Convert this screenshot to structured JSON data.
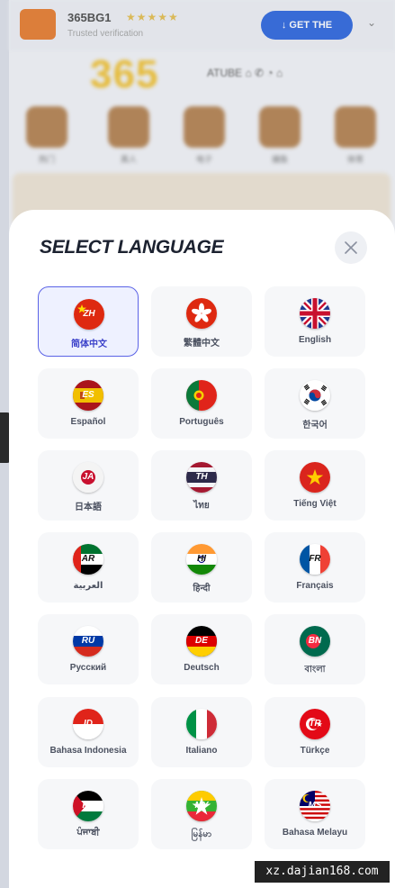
{
  "background": {
    "app_name": "365BG1",
    "stars": "★★★★★",
    "subtitle": "Trusted verification",
    "header_button": "↓ GET THE",
    "brand": "365",
    "top_links": "ATUBE   ⌂   ✆   ◔   ⌂",
    "categories": [
      "热门",
      "真人",
      "电子",
      "捕鱼",
      "体育"
    ]
  },
  "sheet": {
    "title": "SELECT LANGUAGE",
    "close_icon": "close-icon"
  },
  "languages": [
    {
      "code": "ZH",
      "label": "简体中文",
      "selected": true
    },
    {
      "code": "",
      "label": "繁體中文",
      "selected": false
    },
    {
      "code": "",
      "label": "English",
      "selected": false
    },
    {
      "code": "ES",
      "label": "Español",
      "selected": false
    },
    {
      "code": "",
      "label": "Português",
      "selected": false
    },
    {
      "code": "",
      "label": "한국어",
      "selected": false
    },
    {
      "code": "JA",
      "label": "日本語",
      "selected": false
    },
    {
      "code": "TH",
      "label": "ไทย",
      "selected": false
    },
    {
      "code": "",
      "label": "Tiếng Việt",
      "selected": false
    },
    {
      "code": "AR",
      "label": "العربية",
      "selected": false
    },
    {
      "code": "HI",
      "label": "हिन्दी",
      "selected": false
    },
    {
      "code": "FR",
      "label": "Français",
      "selected": false
    },
    {
      "code": "RU",
      "label": "Русский",
      "selected": false
    },
    {
      "code": "DE",
      "label": "Deutsch",
      "selected": false
    },
    {
      "code": "BN",
      "label": "বাংলা",
      "selected": false
    },
    {
      "code": "ID",
      "label": "Bahasa Indonesia",
      "selected": false
    },
    {
      "code": "IT",
      "label": "Italiano",
      "selected": false
    },
    {
      "code": "TR",
      "label": "Türkçe",
      "selected": false
    },
    {
      "code": "PA",
      "label": "ਪੰਜਾਬੀ",
      "selected": false
    },
    {
      "code": "MY",
      "label": "မြန်မာ",
      "selected": false
    },
    {
      "code": "MS",
      "label": "Bahasa Melayu",
      "selected": false
    }
  ],
  "colors": {
    "accent": "#5b63e6",
    "selected_bg": "#eef1ff",
    "card_bg": "#f6f7f9"
  },
  "watermark": "xz.dajian168.com"
}
